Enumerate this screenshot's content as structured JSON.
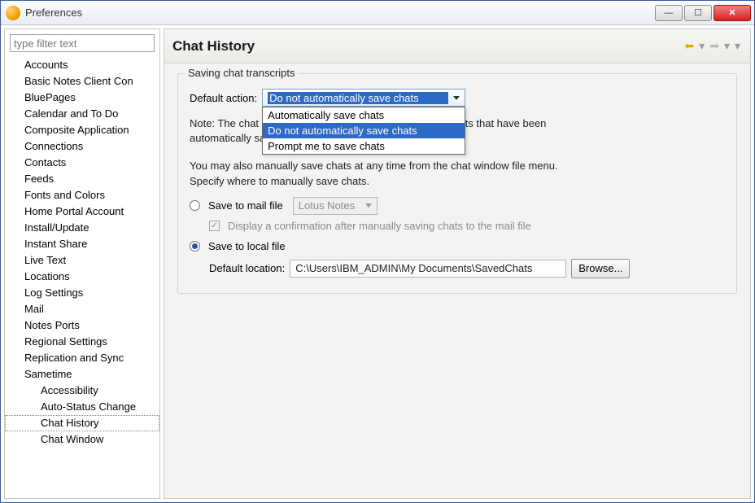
{
  "window": {
    "title": "Preferences"
  },
  "sidebar": {
    "filter_placeholder": "type filter text",
    "items": [
      "Accounts",
      "Basic Notes Client Con",
      "BluePages",
      "Calendar and To Do",
      "Composite Application",
      "Connections",
      "Contacts",
      "Feeds",
      "Fonts and Colors",
      "Home Portal Account",
      "Install/Update",
      "Instant Share",
      "Live Text",
      "Locations",
      "Log Settings",
      "Mail",
      "Notes Ports",
      "Regional Settings",
      "Replication and Sync",
      "Sametime"
    ],
    "children": [
      "Accessibility",
      "Auto-Status Change",
      "Chat History",
      "Chat Window"
    ],
    "selected_child": "Chat History"
  },
  "content": {
    "title": "Chat History",
    "group_title": "Saving chat transcripts",
    "default_action_label": "Default action:",
    "default_action_selected": "Do not automatically save chats",
    "default_action_options": [
      "Automatically save chats",
      "Do not automatically save chats",
      "Prompt me to save chats"
    ],
    "note1": "Note: The chat history table on the contact list displays chats that have been automatically saved.",
    "note2": "You may also manually save chats at any time from the chat window file menu. Specify where to manually save chats.",
    "save_mail_label": "Save to mail file",
    "mail_combo_value": "Lotus Notes",
    "confirm_label": "Display a confirmation after manually saving chats to the mail file",
    "save_local_label": "Save to local file",
    "default_location_label": "Default location:",
    "default_location_value": "C:\\Users\\IBM_ADMIN\\My Documents\\SavedChats",
    "browse_label": "Browse..."
  }
}
